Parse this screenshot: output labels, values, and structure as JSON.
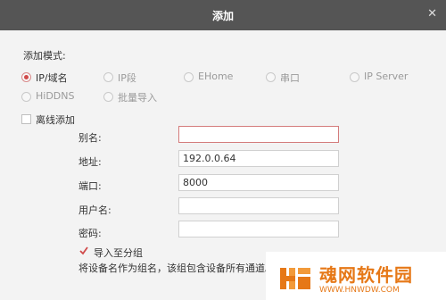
{
  "dialog": {
    "title": "添加"
  },
  "mode": {
    "heading": "添加模式:",
    "options": [
      "IP/域名",
      "IP段",
      "EHome",
      "串口",
      "IP Server",
      "HiDDNS",
      "批量导入"
    ]
  },
  "offline_label": "离线添加",
  "fields": {
    "alias": {
      "label": "别名:",
      "value": ""
    },
    "address": {
      "label": "地址:",
      "value": "192.0.0.64"
    },
    "port": {
      "label": "端口:",
      "value": "8000"
    },
    "username": {
      "label": "用户名:",
      "value": ""
    },
    "password": {
      "label": "密码:",
      "value": ""
    }
  },
  "import_group": {
    "label": "导入至分组",
    "checked": true
  },
  "note": "将设备名作为组名，该组包含设备所有通道。",
  "watermark": {
    "brand": "魂网软件园",
    "url": "WWW.HNWDW.COM"
  },
  "colors": {
    "titlebar": "#555555",
    "accent": "#d04a4a",
    "watermark": "#e67817"
  }
}
